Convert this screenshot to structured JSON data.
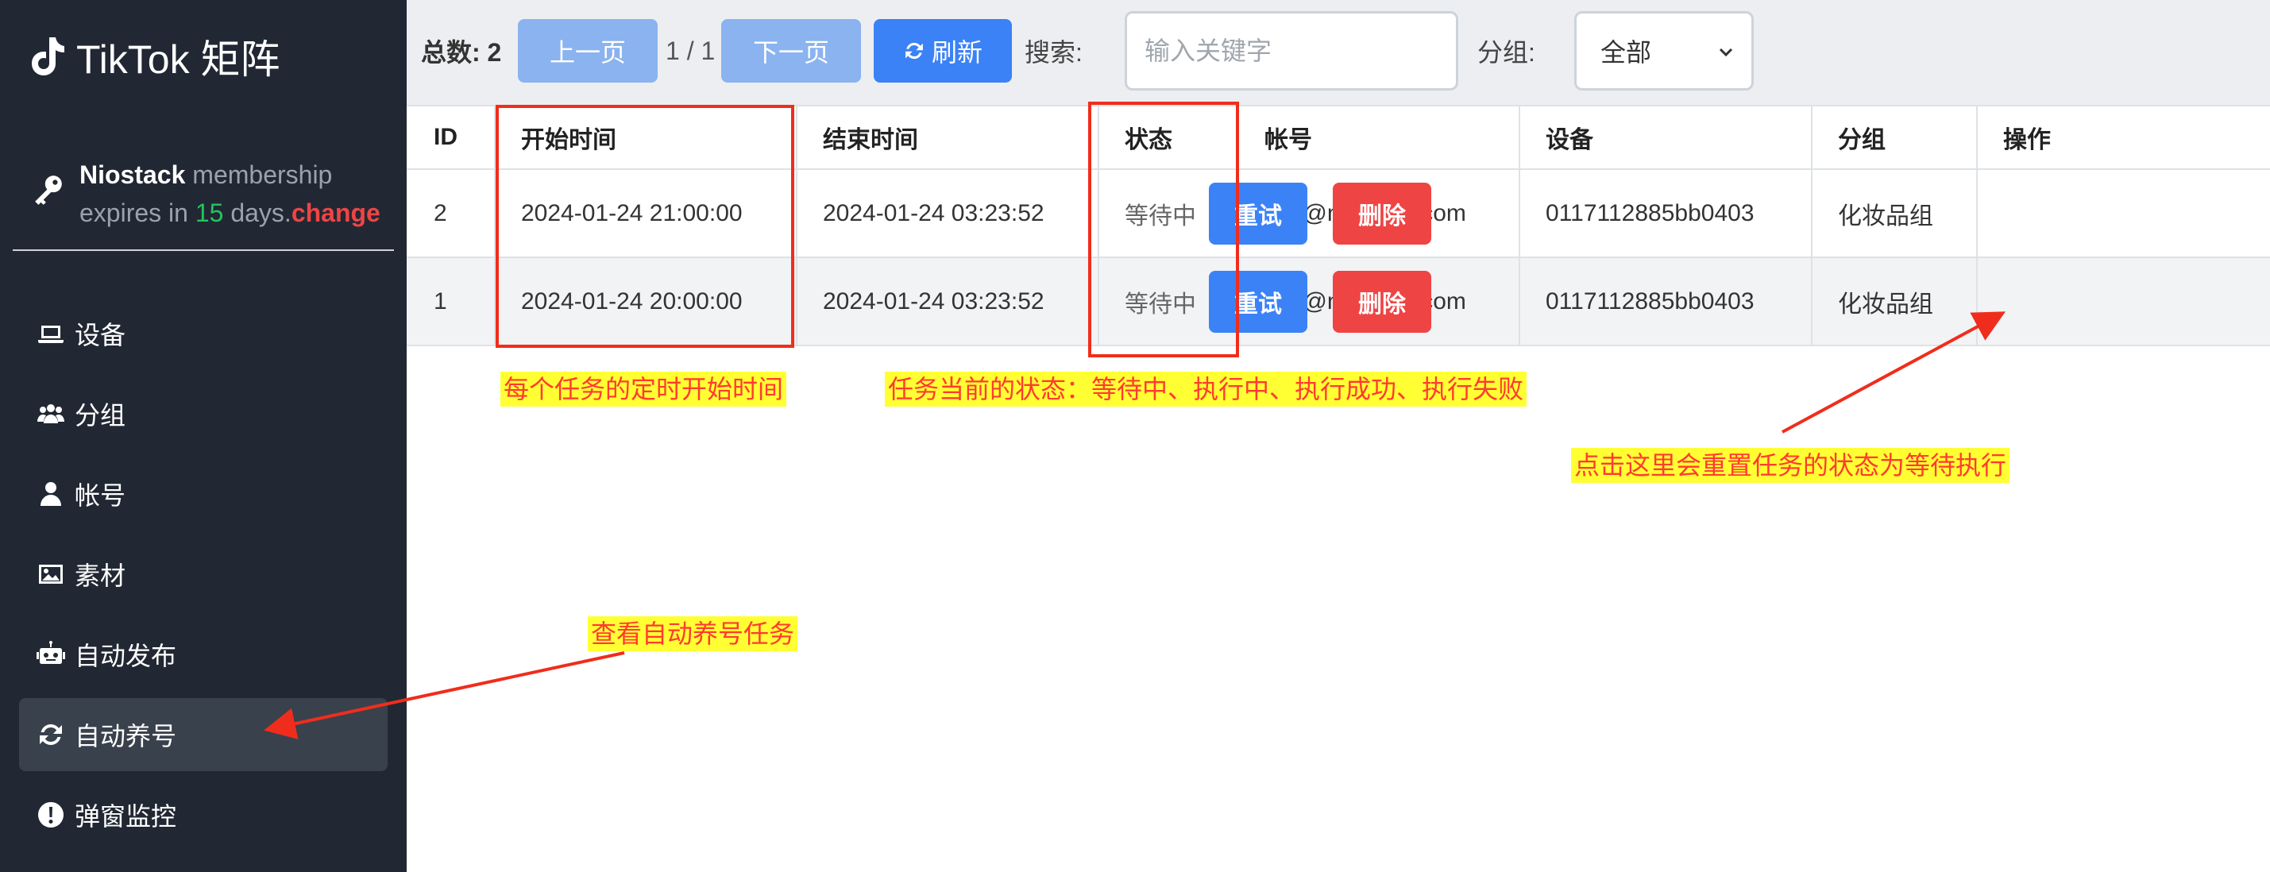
{
  "sidebar": {
    "brand": "TikTok 矩阵",
    "membership": {
      "name": "Niostack",
      "text1": " membership",
      "text2": "expires in ",
      "days": "15",
      "text3": " days.",
      "change": "change"
    },
    "items": [
      {
        "label": "设备",
        "icon": "laptop-icon"
      },
      {
        "label": "分组",
        "icon": "users-icon"
      },
      {
        "label": "帐号",
        "icon": "user-icon"
      },
      {
        "label": "素材",
        "icon": "image-icon"
      },
      {
        "label": "自动发布",
        "icon": "robot-icon"
      },
      {
        "label": "自动养号",
        "icon": "sync-icon",
        "active": true
      },
      {
        "label": "弹窗监控",
        "icon": "alert-icon"
      }
    ]
  },
  "toolbar": {
    "total": "总数: 2",
    "prev": "上一页",
    "page": "1 / 1",
    "next": "下一页",
    "refresh": "刷新",
    "search_label": "搜索:",
    "search_placeholder": "输入关键字",
    "group_label": "分组:",
    "group_value": "全部"
  },
  "table": {
    "headers": [
      "ID",
      "开始时间",
      "结束时间",
      "状态",
      "帐号",
      "设备",
      "分组",
      "操作"
    ],
    "rows": [
      {
        "id": "2",
        "start": "2024-01-24 21:00:00",
        "end": "2024-01-24 03:23:52",
        "status": "等待中",
        "account": "abc@niostack.com",
        "device": "0117112885bb0403",
        "group": "化妆品组"
      },
      {
        "id": "1",
        "start": "2024-01-24 20:00:00",
        "end": "2024-01-24 03:23:52",
        "status": "等待中",
        "account": "abc@niostack.com",
        "device": "0117112885bb0403",
        "group": "化妆品组"
      }
    ],
    "retry": "重试",
    "delete": "删除"
  },
  "annotations": {
    "start_time": "每个任务的定时开始时间",
    "status": "任务当前的状态：等待中、执行中、执行成功、执行失败",
    "retry": "点击这里会重置任务的状态为等待执行",
    "nurture": "查看自动养号任务"
  },
  "colors": {
    "sidebar_bg": "#212833",
    "primary": "#3b82f6",
    "danger": "#ef4444",
    "success": "#22c55e",
    "annotation_red": "#f02d1c",
    "annotation_bg": "#ffff33"
  }
}
